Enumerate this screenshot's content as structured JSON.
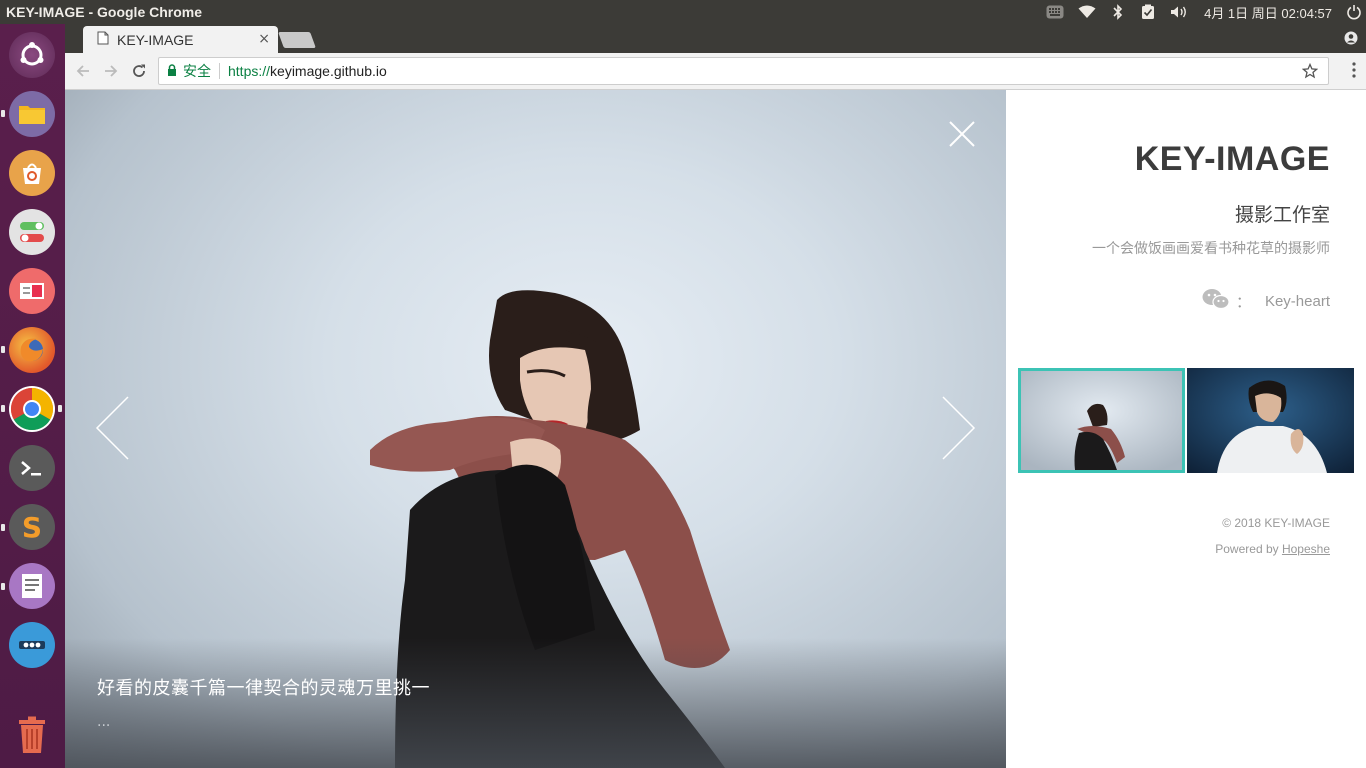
{
  "os_panel": {
    "window_title": "KEY-IMAGE - Google Chrome",
    "clock": "4月 1日 周日 02:04:57",
    "tray_icons": [
      "keyboard-icon",
      "wifi-icon",
      "bluetooth-icon",
      "battery-icon",
      "volume-icon",
      "power-icon"
    ]
  },
  "launcher": {
    "items": [
      "ubuntu-dash-icon",
      "files-icon",
      "software-center-icon",
      "settings-icon",
      "impress-icon",
      "firefox-icon",
      "chrome-icon",
      "terminal-icon",
      "sublime-text-icon",
      "text-editor-icon",
      "more-apps-icon",
      "trash-icon"
    ]
  },
  "browser": {
    "tab_title": "KEY-IMAGE",
    "tab_close": "×",
    "security_label": "安全",
    "url_scheme": "https://",
    "url_host": "keyimage.github.io",
    "colors": {
      "secure": "#0b8043",
      "accent": "#3cc3b5"
    }
  },
  "viewer": {
    "caption": "好看的皮囊千篇一律契合的灵魂万里挑一",
    "caption_more": "..."
  },
  "sidebar": {
    "title": "KEY-IMAGE",
    "subtitle": "摄影工作室",
    "description": "一个会做饭画画爱看书种花草的摄影师",
    "wechat_colon": "：",
    "wechat_id": "Key-heart",
    "copyright": "© 2018 KEY-IMAGE",
    "powered_prefix": "Powered by ",
    "powered_link": "Hopeshe"
  }
}
